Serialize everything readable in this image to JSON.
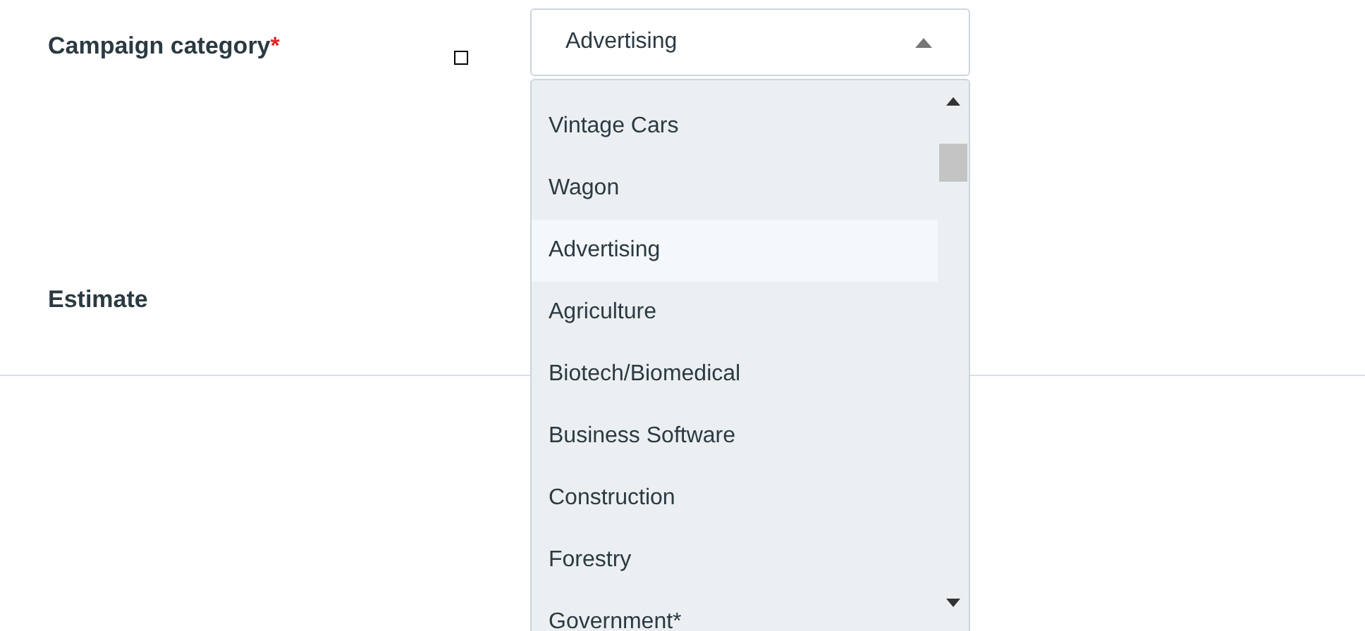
{
  "form": {
    "fields": [
      {
        "label": "Campaign category",
        "required_mark": "*"
      },
      {
        "label": "Estimate"
      }
    ]
  },
  "select": {
    "value": "Advertising",
    "expanded": true
  },
  "options": [
    {
      "label": "Vintage Cars",
      "selected": false
    },
    {
      "label": "Wagon",
      "selected": false
    },
    {
      "label": "Advertising",
      "selected": true
    },
    {
      "label": "Agriculture",
      "selected": false
    },
    {
      "label": "Biotech/Biomedical",
      "selected": false
    },
    {
      "label": "Business Software",
      "selected": false
    },
    {
      "label": "Construction",
      "selected": false
    },
    {
      "label": "Forestry",
      "selected": false
    },
    {
      "label": "Government*",
      "selected": false
    }
  ]
}
